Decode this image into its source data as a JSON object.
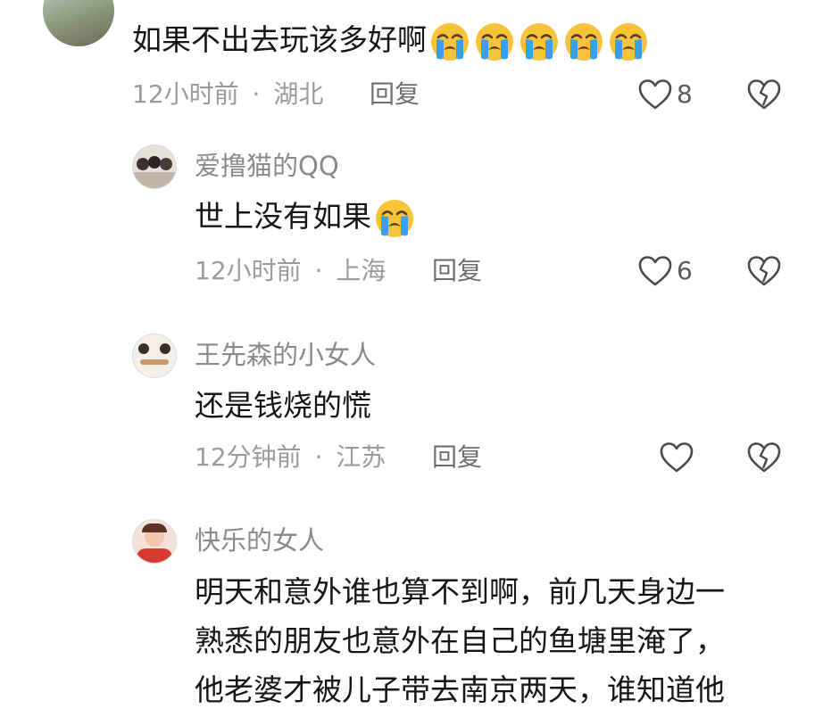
{
  "comments": [
    {
      "name": "",
      "text": "如果不出去玩该多好啊",
      "emoji": "loudly-crying-face",
      "emoji_count": 5,
      "time": "12小时前",
      "location": "湖北",
      "reply": "回复",
      "likes": "8"
    }
  ],
  "replies": [
    {
      "name": "爱撸猫的QQ",
      "text": "世上没有如果",
      "emoji": "loudly-crying-face",
      "time": "12小时前",
      "location": "上海",
      "reply": "回复",
      "likes": "6"
    },
    {
      "name": "王先森的小女人",
      "text": "还是钱烧的慌",
      "time": "12分钟前",
      "location": "江苏",
      "reply": "回复",
      "likes": ""
    },
    {
      "name": "快乐的女人",
      "lines": [
        "明天和意外谁也算不到啊，前几天身边一",
        "熟悉的朋友也意外在自己的鱼塘里淹了，",
        "他老婆才被儿子带去南京两天，谁知道他"
      ]
    }
  ],
  "separator": "·",
  "colors": {
    "meta": "#9b9b9b",
    "name": "#8a8a8a",
    "text": "#161616",
    "emoji_face": "#f6c33a",
    "emoji_tear": "#3aa0e8"
  }
}
